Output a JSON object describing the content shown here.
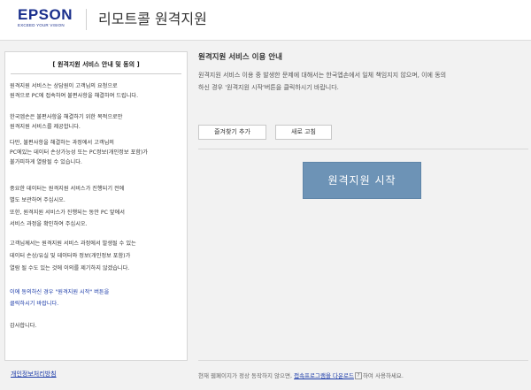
{
  "header": {
    "logo_text": "EPSON",
    "logo_tagline": "EXCEED YOUR VISION",
    "title": "리모트콜 원격지원"
  },
  "notice": {
    "title": "[ 원격지원 서비스 안내 및 동의 ]",
    "lines": [
      "원격지원 서비스는 상담원이 고객님의 요청으로",
      "원격으로 PC에 접속하여 불편사항을 해결하여 드립니다.",
      "한국엡손은 불편사항을 해결하기 위한 목적으로만",
      "원격지원 서비스를 제공합니다.",
      "다만, 불편사항을 해결하는 과정에서 고객님의",
      "PC에있는 데이터 손상가능성 또는 PC정보(개인정보 포함)가",
      "불가피하게 열람될 수 있습니다.",
      "중요한 데이터는 원격지원 서비스가 진행되기 전에",
      "별도 보관하여 주십시오.",
      "또한, 원격지원 서비스가 진행되는 동안 PC 앞에서",
      "서비스 과정을 확인하여 주십시오.",
      "고객님께서는 원격지원 서비스 과정에서 발생될 수 있는",
      "데이터 손상/유실 및 데이터와 정보(개인정보 포함)가",
      "열람 될 수도 있는 것에 이의를 제기하지 않겠습니다.",
      "이에 동의하신 경우 \"원격지원 시작\" 버튼을",
      "클릭하시기 바랍니다.",
      "감사합니다."
    ]
  },
  "privacy_link": "개인정보처리방침",
  "main": {
    "section_title": "원격지원 서비스 이용 안내",
    "desc_line1": "원격지원 서비스 이용 중 발생한 문제에 대해서는 한국엡손에서 일체 책임지지 않으며, 이에 동의",
    "desc_line2": "하신 경우 '원격지원 시작'버튼을 클릭하시기 바랍니다.",
    "favorite_button": "즐겨찾기 추가",
    "refresh_button": "새로 고침",
    "start_button": "원격지원 시작"
  },
  "footer": {
    "msg_prefix": "현재 웹페이지가 정상 동작하지 않으면,",
    "download_link": "접속프로그램을 다운로드",
    "help_mark": "?",
    "msg_suffix": "하여 사용하세요."
  },
  "colors": {
    "brand": "#1a2f8c",
    "start_button": "#6d93b6",
    "link": "#1a3aa8"
  }
}
